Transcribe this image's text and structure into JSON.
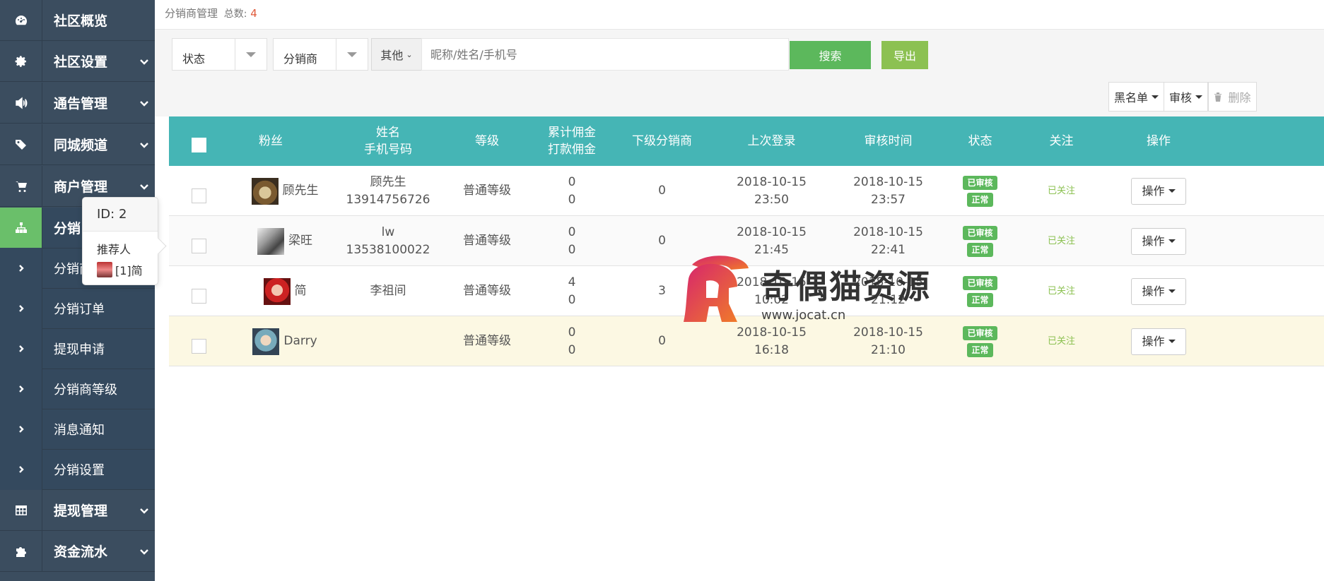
{
  "sidebar": {
    "items": [
      {
        "label": "社区概览",
        "icon": "dashboard-icon",
        "chevron": false
      },
      {
        "label": "社区设置",
        "icon": "gear-icon",
        "chevron": true
      },
      {
        "label": "通告管理",
        "icon": "volume-icon",
        "chevron": true
      },
      {
        "label": "同城频道",
        "icon": "tags-icon",
        "chevron": true
      },
      {
        "label": "商户管理",
        "icon": "cart-icon",
        "chevron": true
      },
      {
        "label": "分销",
        "icon": "sitemap-icon",
        "chevron": false
      }
    ],
    "sub_items": [
      {
        "label": "分销商"
      },
      {
        "label": "分销订单"
      },
      {
        "label": "提现申请"
      },
      {
        "label": "分销商等级"
      },
      {
        "label": "消息通知"
      },
      {
        "label": "分销设置"
      }
    ],
    "bottom_items": [
      {
        "label": "提现管理",
        "icon": "table-icon"
      },
      {
        "label": "资金流水",
        "icon": "puzzle-icon"
      }
    ]
  },
  "popover": {
    "title": "ID: 2",
    "label": "推荐人",
    "referrer": "[1]简"
  },
  "header": {
    "breadcrumb": "分销商管理",
    "total_label": "总数:",
    "total_count": "4"
  },
  "filters": {
    "status_label": "状态",
    "distributor_label": "分销商",
    "other_label": "其他",
    "search_placeholder": "昵称/姓名/手机号",
    "search_button": "搜索",
    "export_button": "导出"
  },
  "toolbar": {
    "blacklist": "黑名单",
    "review": "审核",
    "delete": "删除"
  },
  "table": {
    "headers": {
      "fans": "粉丝",
      "name": "姓名",
      "phone": "手机号码",
      "level": "等级",
      "total_commission": "累计佣金",
      "paid_commission": "打款佣金",
      "sub_distributors": "下级分销商",
      "last_login": "上次登录",
      "review_time": "审核时间",
      "status": "状态",
      "follow": "关注",
      "action": "操作"
    },
    "rows": [
      {
        "nick": "顾先生",
        "name": "顾先生",
        "phone": "13914756726",
        "level": "普通等级",
        "total": "0",
        "paid": "0",
        "subs": "0",
        "login_date": "2018-10-15",
        "login_time": "23:50",
        "review_date": "2018-10-15",
        "review_time": "23:57",
        "status1": "已审核",
        "status2": "正常",
        "follow": "已关注",
        "action": "操作"
      },
      {
        "nick": "梁旺",
        "name": "lw",
        "phone": "13538100022",
        "level": "普通等级",
        "total": "0",
        "paid": "0",
        "subs": "0",
        "login_date": "2018-10-15",
        "login_time": "21:45",
        "review_date": "2018-10-15",
        "review_time": "22:41",
        "status1": "已审核",
        "status2": "正常",
        "follow": "已关注",
        "action": "操作"
      },
      {
        "nick": "简",
        "name": "李祖间",
        "phone": "",
        "level": "普通等级",
        "total": "4",
        "paid": "0",
        "subs": "3",
        "login_date": "2018-10-15",
        "login_time": "10:02",
        "review_date": "2018-10-15",
        "review_time": "21:12",
        "status1": "已审核",
        "status2": "正常",
        "follow": "已关注",
        "action": "操作"
      },
      {
        "nick": "Darry",
        "name": "",
        "phone": "",
        "level": "普通等级",
        "total": "0",
        "paid": "0",
        "subs": "0",
        "login_date": "2018-10-15",
        "login_time": "16:18",
        "review_date": "2018-10-15",
        "review_time": "21:10",
        "status1": "已审核",
        "status2": "正常",
        "follow": "已关注",
        "action": "操作"
      }
    ]
  },
  "watermark": {
    "text": "奇偶猫资源",
    "url": "www.jocat.cn"
  },
  "colors": {
    "sidebar_bg": "#3b4d5f",
    "active_green": "#6abf6a",
    "table_header": "#45b5b5",
    "badge_green": "#5cb85c",
    "count_red": "#e05a3a",
    "highlight_row": "#fcf8e3"
  }
}
